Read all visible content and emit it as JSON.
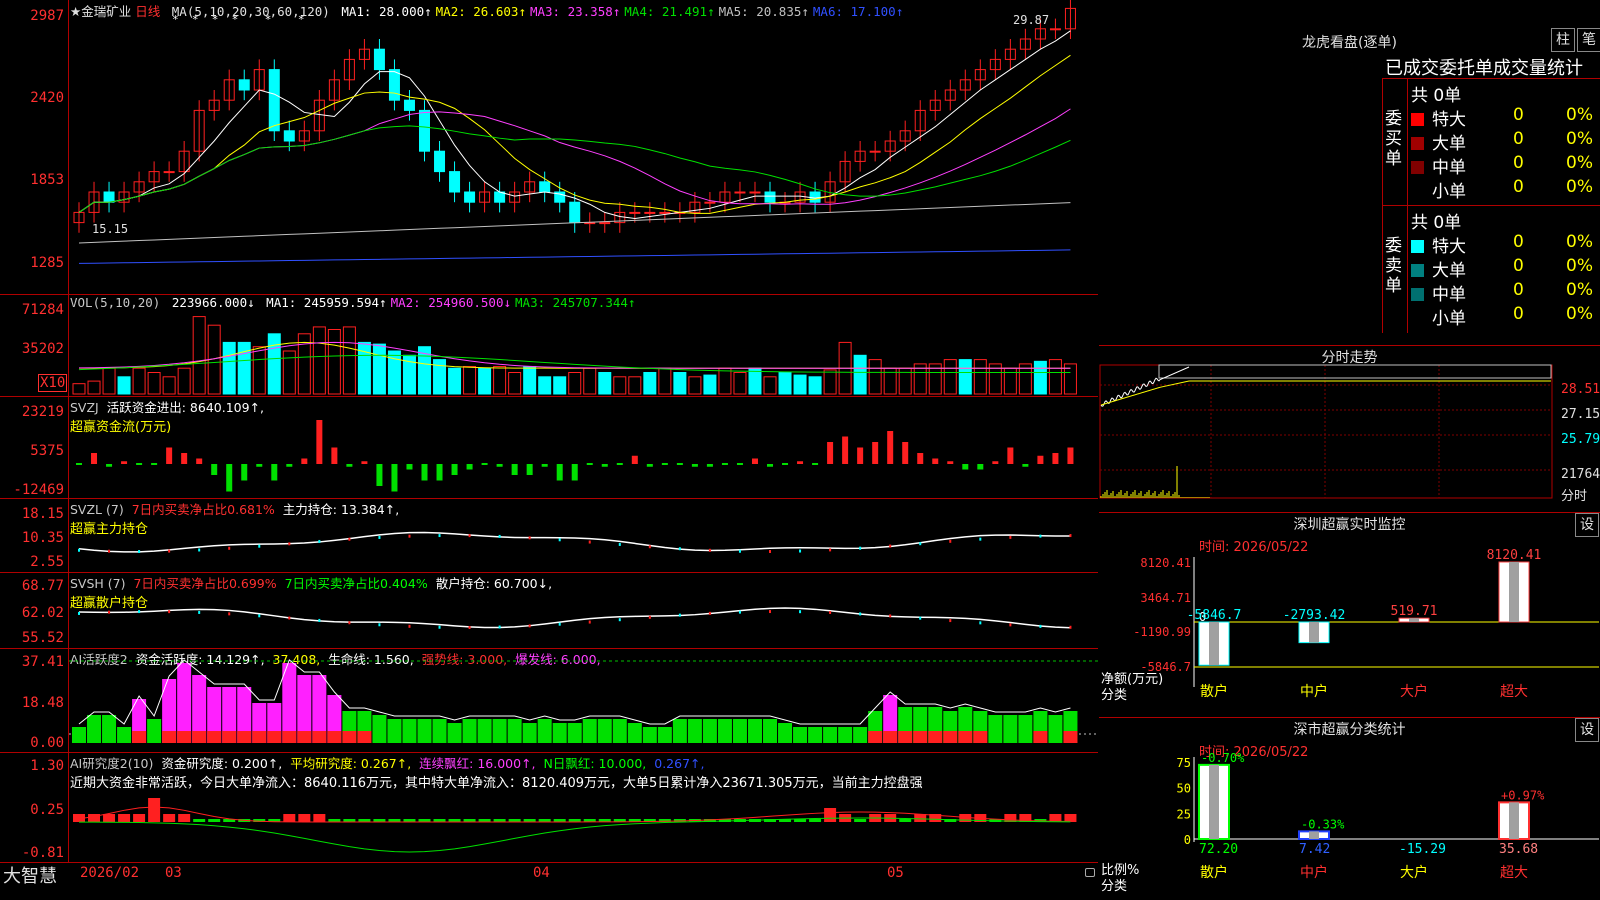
{
  "stock": {
    "name": "★金瑞矿业",
    "period": "日线",
    "ma_label": "MA(5,10,20,30,60,120)",
    "ma": [
      {
        "label": "MA1: 28.000↑",
        "color": "#ffffff"
      },
      {
        "label": "MA2: 26.603↑",
        "color": "#ffff00"
      },
      {
        "label": "MA3: 23.358↑",
        "color": "#ff40ff"
      },
      {
        "label": "MA4: 21.491↑",
        "color": "#00e000"
      },
      {
        "label": "MA5: 20.835↑",
        "color": "#c0c0c0"
      },
      {
        "label": "MA6: 17.100↑",
        "color": "#3050ff"
      }
    ],
    "high_label": "29.87",
    "low_label": "15.15",
    "stars": "*  *  *  *    *    *"
  },
  "price_axis": [
    "2987",
    "2420",
    "1853",
    "1285"
  ],
  "vol": {
    "label": "VOL(5,10,20)",
    "value": "223966.000↓",
    "ma": [
      {
        "label": "MA1: 245959.594↑",
        "color": "#ffffff"
      },
      {
        "label": "MA2: 254960.500↓",
        "color": "#ff40ff"
      },
      {
        "label": "MA3: 245707.344↑",
        "color": "#00e000"
      }
    ],
    "axis": [
      "71284",
      "35202"
    ],
    "unit": "X10",
    "bars": [
      0.12,
      0.15,
      0.3,
      0.2,
      0.3,
      0.25,
      0.2,
      0.3,
      0.9,
      0.8,
      0.6,
      0.6,
      0.55,
      0.7,
      0.5,
      0.7,
      0.78,
      0.75,
      0.78,
      0.6,
      0.58,
      0.5,
      0.45,
      0.55,
      0.4,
      0.3,
      0.32,
      0.3,
      0.32,
      0.25,
      0.32,
      0.2,
      0.2,
      0.25,
      0.3,
      0.25,
      0.2,
      0.2,
      0.25,
      0.3,
      0.25,
      0.2,
      0.22,
      0.3,
      0.25,
      0.3,
      0.2,
      0.25,
      0.22,
      0.2,
      0.28,
      0.6,
      0.45,
      0.4,
      0.3,
      0.3,
      0.35,
      0.35,
      0.4,
      0.4,
      0.4,
      0.35,
      0.3,
      0.35,
      0.38,
      0.4,
      0.35,
      0.38,
      0.28,
      0.3
    ],
    "up": [
      1,
      1,
      1,
      0,
      1,
      1,
      1,
      1,
      1,
      1,
      0,
      0,
      1,
      0,
      1,
      1,
      1,
      1,
      1,
      0,
      0,
      0,
      0,
      0,
      0,
      0,
      1,
      0,
      1,
      1,
      0,
      0,
      0,
      1,
      1,
      0,
      1,
      1,
      0,
      1,
      0,
      1,
      0,
      1,
      1,
      0,
      1,
      0,
      0,
      0,
      1,
      1,
      0,
      1,
      1,
      1,
      1,
      1,
      1,
      0,
      1,
      1,
      1,
      1,
      0,
      1,
      1,
      0,
      1,
      1
    ]
  },
  "svzj": {
    "label": "SVZJ",
    "name": "活跃资金进出: 8640.109↑,",
    "sub": "超赢资金流(万元)",
    "axis": [
      "23219",
      "5375",
      "-12469"
    ],
    "bars": [
      0,
      0.2,
      -0.05,
      0.05,
      0,
      0,
      0.3,
      0.2,
      0.1,
      -0.2,
      -0.5,
      -0.3,
      -0.05,
      -0.3,
      -0.05,
      0.1,
      0.8,
      0.3,
      -0.05,
      0.05,
      -0.4,
      -0.5,
      -0.1,
      -0.3,
      -0.3,
      -0.2,
      -0.1,
      0,
      -0.05,
      -0.2,
      -0.2,
      -0.05,
      -0.3,
      -0.3,
      0,
      -0.05,
      0,
      0.15,
      -0.05,
      0,
      0,
      -0.05,
      -0.05,
      0,
      0,
      0.1,
      -0.05,
      0,
      0.05,
      0,
      0.4,
      0.5,
      0.3,
      0.4,
      0.6,
      0.4,
      0.2,
      0.1,
      0.05,
      -0.1,
      -0.1,
      0.05,
      0.3,
      -0.05,
      0.15,
      0.2,
      0.3
    ]
  },
  "svzl": {
    "label": "SVZL (7)",
    "a": "7日内买卖净占比0.681%",
    "b": "主力持仓: 13.384↑,",
    "sub": "超赢主力持仓",
    "axis": [
      "18.15",
      "10.35",
      "2.55"
    ]
  },
  "svsh": {
    "label": "SVSH (7)",
    "a": "7日内买卖净占比0.699%",
    "b": "7日内买卖净占比0.404%",
    "c": "散户持仓: 60.700↓,",
    "sub": "超赢散户持仓",
    "axis": [
      "68.77",
      "62.02",
      "55.52"
    ]
  },
  "ai1": {
    "label": "AI活跃度2",
    "a": "资金活跃度: 14.129↑,",
    "b": "37.408,",
    "c": "生命线: 1.560,",
    "d": "强势线: 3.000,",
    "e": "爆发线: 6.000,",
    "axis": [
      "37.41",
      "18.48",
      "0.00"
    ],
    "bars": [
      0.2,
      0.35,
      0.35,
      0.2,
      0.55,
      0.3,
      0.8,
      1.0,
      0.85,
      0.7,
      0.7,
      0.7,
      0.5,
      0.5,
      1.0,
      0.85,
      0.85,
      0.6,
      0.4,
      0.4,
      0.35,
      0.3,
      0.3,
      0.3,
      0.3,
      0.25,
      0.3,
      0.3,
      0.3,
      0.3,
      0.25,
      0.3,
      0.25,
      0.25,
      0.3,
      0.3,
      0.3,
      0.25,
      0.2,
      0.2,
      0.3,
      0.3,
      0.3,
      0.3,
      0.3,
      0.3,
      0.3,
      0.25,
      0.2,
      0.2,
      0.2,
      0.2,
      0.2,
      0.4,
      0.6,
      0.45,
      0.45,
      0.45,
      0.4,
      0.45,
      0.4,
      0.35,
      0.35,
      0.35,
      0.4,
      0.35,
      0.4,
      0.35,
      0.45
    ]
  },
  "ai2": {
    "label": "AI研究度2(10)",
    "a": "资金研究度: 0.200↑,",
    "b": "平均研究度: 0.267↑,",
    "c": "连续飘红: 16.000↑,",
    "d": "N日飘红: 10.000,",
    "e": "0.267↑,",
    "text": "近期大资金非常活跃，今日大单净流入：8640.116万元，其中特大单净流入：8120.409万元，大单5日累计净入23671.305万元，当前主力控盘强",
    "axis": [
      "1.30",
      "0.25",
      "-0.81"
    ]
  },
  "xaxis": {
    "logo": "大智慧",
    "labels": [
      "2026/02",
      "03",
      "04",
      "05"
    ]
  },
  "lhb": {
    "title": "龙虎看盘(逐单)",
    "btn_bar": "柱",
    "btn_pen": "笔",
    "tabs": "已成交委托单成交量统计",
    "buy": {
      "label": "委买单",
      "total": "共 0单",
      "rows": [
        {
          "name": "特大",
          "n": "0",
          "p": "0%",
          "color": "#ff0000"
        },
        {
          "name": "大单",
          "n": "0",
          "p": "0%",
          "color": "#a00000"
        },
        {
          "name": "中单",
          "n": "0",
          "p": "0%",
          "color": "#800000"
        },
        {
          "name": "小单",
          "n": "0",
          "p": "0%",
          "color": "#000000"
        }
      ]
    },
    "sell": {
      "label": "委卖单",
      "total": "共 0单",
      "rows": [
        {
          "name": "特大",
          "n": "0",
          "p": "0%",
          "color": "#00ffff"
        },
        {
          "name": "大单",
          "n": "0",
          "p": "0%",
          "color": "#008080"
        },
        {
          "name": "中单",
          "n": "0",
          "p": "0%",
          "color": "#007070"
        },
        {
          "name": "小单",
          "n": "0",
          "p": "0%",
          "color": "#000000"
        }
      ]
    }
  },
  "fenshi": {
    "title": "分时走势",
    "axis": [
      "28.51",
      "27.15",
      "25.79",
      "21764",
      "分时"
    ]
  },
  "monitor": {
    "title": "深圳超赢实时监控",
    "btn": "设",
    "time": "时间: 2026/05/22",
    "axis": [
      "8120.41",
      "3464.71",
      "-1190.99",
      "-5846.7"
    ],
    "zero": "0",
    "ylabel": "净额(万元)",
    "xlabel": "分类",
    "cats": [
      {
        "name": "散户",
        "value": -5846.7,
        "label": "-5846.7",
        "color": "#00ffff"
      },
      {
        "name": "中户",
        "value": -2793.42,
        "label": "-2793.42",
        "color": "#00ffff"
      },
      {
        "name": "大户",
        "value": 519.71,
        "label": "519.71",
        "color": "#ff4040"
      },
      {
        "name": "超大",
        "value": 8120.41,
        "label": "8120.41",
        "color": "#ff4040"
      }
    ]
  },
  "stats": {
    "title": "深市超赢分类统计",
    "btn": "设",
    "time": "时间: 2026/05/22",
    "axis": [
      "75",
      "50",
      "25",
      "0"
    ],
    "ylabel": "比例%",
    "xlabel": "分类",
    "cats": [
      {
        "name": "散户",
        "ratio": 72.2,
        "label": "72.20",
        "chg": "-0.70%",
        "color": "#00ff00",
        "vcolor": "#00ff00"
      },
      {
        "name": "中户",
        "ratio": 7.42,
        "label": "7.42",
        "chg": "-0.33%",
        "color": "#2040ff",
        "vcolor": "#3060ff"
      },
      {
        "name": "大户",
        "ratio": -15.29,
        "label": "-15.29",
        "chg": "",
        "color": "#00ffff",
        "vcolor": "#00ffff"
      },
      {
        "name": "超大",
        "ratio": 35.68,
        "label": "35.68",
        "chg": "+0.97%",
        "color": "#ff3030",
        "vcolor": "#ff8080"
      }
    ]
  }
}
